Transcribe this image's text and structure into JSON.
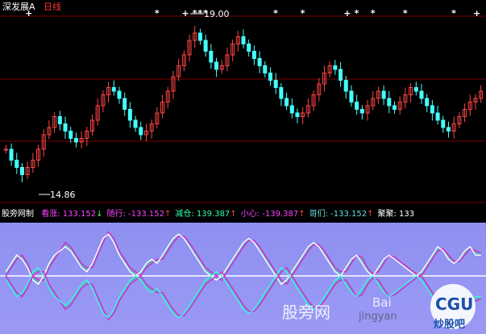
{
  "top_panel": {
    "symbol": "深发展A",
    "period": "日线",
    "high_label": "19.00",
    "low_label": "14.86"
  },
  "indicator_panel": {
    "name": "股旁网制",
    "items": [
      {
        "label": "看涨:",
        "value": "133.152",
        "arrow": "↓",
        "label_color": "#ff44ff",
        "value_color": "#ff44ff"
      },
      {
        "label": "随行:",
        "value": "-133.152",
        "arrow": "↑",
        "label_color": "#ff44ff",
        "value_color": "#ff44ff"
      },
      {
        "label": "减仓:",
        "value": "139.387",
        "arrow": "↑",
        "label_color": "#33ffaa",
        "value_color": "#33ffaa"
      },
      {
        "label": "小心:",
        "value": "-139.387",
        "arrow": "↑",
        "label_color": "#ff44ff",
        "value_color": "#ff44ff"
      },
      {
        "label": "哥们:",
        "value": "-133.152",
        "arrow": "↑",
        "label_color": "#66dddd",
        "value_color": "#66dddd"
      },
      {
        "label": "聚聚:",
        "value": "133",
        "arrow": "",
        "label_color": "#ffffff",
        "value_color": "#ffffff"
      }
    ]
  },
  "watermarks": {
    "site": "股旁网",
    "baidu": "Bai",
    "jingyan": "jingyan",
    "logo_text": "CGU",
    "logo_sub": "炒股吧"
  },
  "chart_data": {
    "type": "candlestick",
    "ylim": [
      14.2,
      19.4
    ],
    "closes": [
      15.6,
      15.3,
      15.1,
      14.9,
      15.1,
      15.3,
      15.6,
      16.0,
      16.2,
      16.5,
      16.3,
      16.1,
      15.9,
      15.8,
      15.9,
      16.1,
      16.4,
      16.8,
      17.1,
      17.3,
      17.2,
      17.0,
      16.7,
      16.4,
      16.2,
      16.0,
      16.1,
      16.3,
      16.6,
      16.9,
      17.2,
      17.6,
      17.9,
      18.2,
      18.6,
      18.8,
      18.6,
      18.3,
      18.0,
      17.8,
      17.9,
      18.2,
      18.5,
      18.7,
      18.5,
      18.3,
      18.1,
      17.9,
      17.7,
      17.5,
      17.3,
      17.0,
      16.8,
      16.6,
      16.5,
      16.6,
      16.8,
      17.1,
      17.4,
      17.7,
      17.9,
      17.8,
      17.5,
      17.2,
      16.9,
      16.7,
      16.6,
      16.8,
      17.0,
      17.2,
      17.0,
      16.8,
      16.7,
      16.9,
      17.1,
      17.3,
      17.2,
      17.0,
      16.8,
      16.6,
      16.4,
      16.2,
      16.1,
      16.3,
      16.5,
      16.7,
      16.9,
      17.0,
      17.2
    ],
    "markers": [
      {
        "index": 4,
        "symbol": "+",
        "color": "#ffffff"
      },
      {
        "index": 28,
        "symbol": "*",
        "color": "#ffffff"
      },
      {
        "index": 33,
        "symbol": "+",
        "color": "#ffffff"
      },
      {
        "index": 35,
        "symbol": "*",
        "color": "#ffffff"
      },
      {
        "index": 36,
        "symbol": "*",
        "color": "#ffffff"
      },
      {
        "index": 37,
        "symbol": "*",
        "color": "#ffffff"
      },
      {
        "index": 50,
        "symbol": "*",
        "color": "#ffffff"
      },
      {
        "index": 55,
        "symbol": "*",
        "color": "#ffffff"
      },
      {
        "index": 63,
        "symbol": "+",
        "color": "#ffffff"
      },
      {
        "index": 65,
        "symbol": "*",
        "color": "#ffffff"
      },
      {
        "index": 68,
        "symbol": "*",
        "color": "#ffffff"
      },
      {
        "index": 74,
        "symbol": "*",
        "color": "#ffffff"
      },
      {
        "index": 83,
        "symbol": "*",
        "color": "#ffffff"
      },
      {
        "index": 87,
        "symbol": "+",
        "color": "#ffffff"
      }
    ],
    "indicator": {
      "ylim": [
        -1.2,
        1.2
      ],
      "main": [
        0.1,
        0.3,
        0.5,
        0.4,
        0.2,
        -0.1,
        -0.2,
        0.0,
        0.3,
        0.5,
        0.6,
        0.7,
        0.6,
        0.4,
        0.2,
        0.1,
        0.3,
        0.6,
        0.9,
        1.0,
        0.8,
        0.5,
        0.3,
        0.1,
        0.0,
        0.1,
        0.3,
        0.4,
        0.3,
        0.5,
        0.7,
        0.9,
        1.0,
        0.9,
        0.7,
        0.5,
        0.3,
        0.1,
        0.0,
        -0.1,
        0.0,
        0.2,
        0.4,
        0.6,
        0.8,
        0.9,
        0.8,
        0.6,
        0.4,
        0.2,
        0.0,
        -0.2,
        -0.1,
        0.1,
        0.3,
        0.5,
        0.7,
        0.8,
        0.7,
        0.5,
        0.3,
        0.1,
        0.0,
        0.2,
        0.4,
        0.5,
        0.3,
        0.1,
        0.0,
        0.2,
        0.4,
        0.5,
        0.4,
        0.3,
        0.2,
        0.1,
        0.0,
        0.1,
        0.3,
        0.5,
        0.7,
        0.6,
        0.4,
        0.3,
        0.4,
        0.6,
        0.7,
        0.5,
        0.5
      ],
      "secondary": [
        0.0,
        0.2,
        0.4,
        0.5,
        0.3,
        0.0,
        -0.1,
        -0.1,
        0.2,
        0.4,
        0.6,
        0.8,
        0.7,
        0.5,
        0.3,
        0.2,
        0.2,
        0.5,
        0.8,
        1.05,
        0.9,
        0.6,
        0.4,
        0.2,
        0.1,
        0.0,
        0.2,
        0.3,
        0.4,
        0.4,
        0.6,
        0.8,
        0.95,
        0.95,
        0.8,
        0.6,
        0.4,
        0.2,
        0.1,
        0.0,
        -0.1,
        0.1,
        0.3,
        0.5,
        0.7,
        0.85,
        0.85,
        0.7,
        0.5,
        0.3,
        0.1,
        -0.1,
        -0.2,
        0.0,
        0.2,
        0.4,
        0.6,
        0.75,
        0.75,
        0.6,
        0.4,
        0.2,
        0.1,
        0.1,
        0.3,
        0.5,
        0.45,
        0.2,
        0.05,
        0.1,
        0.3,
        0.5,
        0.45,
        0.35,
        0.25,
        0.15,
        0.05,
        0.0,
        0.2,
        0.4,
        0.6,
        0.65,
        0.5,
        0.35,
        0.35,
        0.5,
        0.65,
        0.6,
        0.55
      ]
    }
  }
}
